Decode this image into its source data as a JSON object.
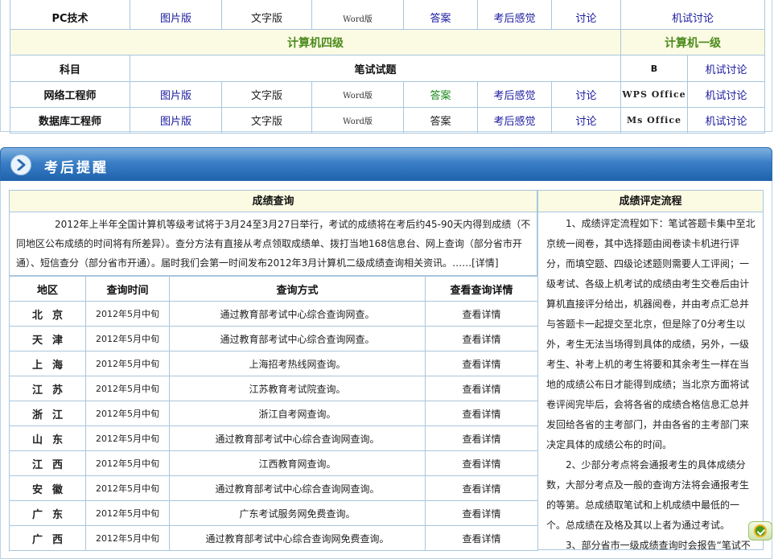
{
  "top_table": {
    "row_pc": {
      "subject": "PC技术",
      "image": "图片版",
      "text": "文字版",
      "word": "Word版",
      "answer": "答案",
      "feeling": "考后感觉",
      "discuss": "讨论",
      "machine": "机试讨论"
    },
    "level_left": "计算机四级",
    "level_right": "计算机一级",
    "header": {
      "subject": "科目",
      "written": "笔试试题",
      "b": "B",
      "machine": "机试讨论"
    },
    "row_network": {
      "subject": "网络工程师",
      "image": "图片版",
      "text": "文字版",
      "word": "Word版",
      "answer": "答案",
      "feeling": "考后感觉",
      "discuss": "讨论",
      "office": "WPS Office",
      "machine": "机试讨论"
    },
    "row_database": {
      "subject": "数据库工程师",
      "image": "图片版",
      "text": "文字版",
      "word": "Word版",
      "answer": "答案",
      "feeling": "考后感觉",
      "discuss": "讨论",
      "office": "Ms Office",
      "machine": "机试讨论"
    }
  },
  "banner": {
    "title": "考后提醒",
    "icon": "chevron-right-icon"
  },
  "score_query": {
    "title": "成绩查询",
    "intro": "2012年上半年全国计算机等级考试将于3月24至3月27日举行，考试的成绩将在考后约45-90天内得到成绩（不同地区公布成绩的时间将有所差异）。查分方法有直接从考点领取成绩单、拨打当地168信息台、网上查询（部分省市开通）、短信查分（部分省市开通）。届时我们会第一时间发布2012年3月计算机二级成绩查询相关资讯。……[详情]",
    "columns": [
      "地区",
      "查询时间",
      "查询方式",
      "查看查询详情"
    ],
    "rows": [
      {
        "region": "北京",
        "time": "2012年5月中旬",
        "method": "通过教育部考试中心综合查询网查。",
        "detail": "查看详情"
      },
      {
        "region": "天津",
        "time": "2012年5月中旬",
        "method": "通过教育部考试中心综合查询网查。",
        "detail": "查看详情"
      },
      {
        "region": "上海",
        "time": "2012年5月中旬",
        "method": "上海招考热线网查询。",
        "detail": "查看详情"
      },
      {
        "region": "江苏",
        "time": "2012年5月中旬",
        "method": "江苏教育考试院查询。",
        "detail": "查看详情"
      },
      {
        "region": "浙江",
        "time": "2012年5月中旬",
        "method": "浙江自考网查询。",
        "detail": "查看详情"
      },
      {
        "region": "山东",
        "time": "2012年5月中旬",
        "method": "通过教育部考试中心综合查询网查询。",
        "detail": "查看详情"
      },
      {
        "region": "江西",
        "time": "2012年5月中旬",
        "method": "江西教育网查询。",
        "detail": "查看详情"
      },
      {
        "region": "安徽",
        "time": "2012年5月中旬",
        "method": "通过教育部考试中心综合查询网查询。",
        "detail": "查看详情"
      },
      {
        "region": "广东",
        "time": "2012年5月中旬",
        "method": "广东考试服务网免费查询。",
        "detail": "查看详情"
      },
      {
        "region": "广西",
        "time": "2012年5月中旬",
        "method": "通过教育部考试中心综合查询网免费查询。",
        "detail": "查看详情"
      }
    ]
  },
  "score_process": {
    "title": "成绩评定流程",
    "p1": "1、成绩评定流程如下：笔试答题卡集中至北京统一阅卷，其中选择题由阅卷读卡机进行评分，而填空题、四级论述题则需要人工评阅；一级考试、各级上机考试的成绩由考生交卷后由计算机直接评分给出，机器阅卷，并由考点汇总并与答题卡一起提交至北京，但是除了0分考生以外，考生无法当场得到具体的成绩，另外，一级考生、补考上机的考生将要和其余考生一样在当地的成绩公布日才能得到成绩；当北京方面将试卷评阅完毕后，会将各省的成绩合格信息汇总并发回给各省的主考部门，并由各省的主考部门来决定具体的成绩公布的时间。",
    "p2": "2、少部分考点将会通报考生的具体成绩分数，大部分考点及一般的查询方法将会通报考生的等第。总成绩取笔试和上机成绩中最低的一个。总成绩在及格及其以上者为通过考试。",
    "p3": "3、部分省市一级成绩查询时会报告“笔试不"
  }
}
